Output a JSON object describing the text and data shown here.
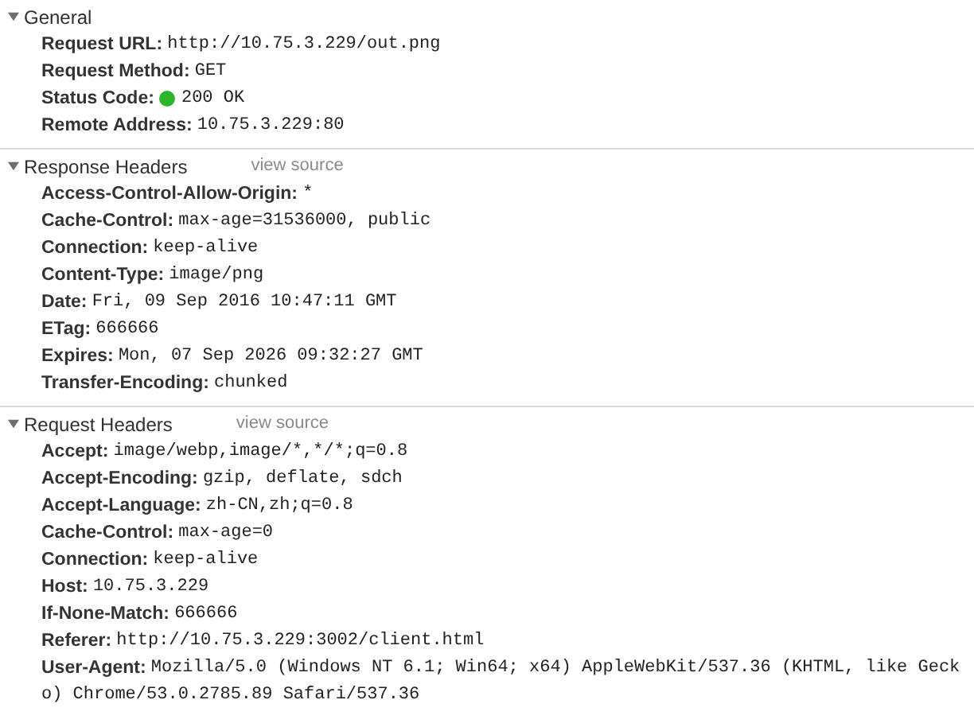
{
  "sections": [
    {
      "title": "General",
      "expanded": true,
      "rows": [
        {
          "name": "Request URL:",
          "value": "http://10.75.3.229/out.png",
          "kind": "plain"
        },
        {
          "name": "Request Method:",
          "value": "GET",
          "kind": "plain"
        },
        {
          "name": "Status Code:",
          "value": "200 OK",
          "kind": "status"
        },
        {
          "name": "Remote Address:",
          "value": "10.75.3.229:80",
          "kind": "plain"
        }
      ]
    },
    {
      "title": "Response Headers",
      "link": "view source",
      "expanded": true,
      "rows": [
        {
          "name": "Access-Control-Allow-Origin:",
          "value": "*",
          "kind": "plain"
        },
        {
          "name": "Cache-Control:",
          "value": "max-age=31536000, public",
          "kind": "plain"
        },
        {
          "name": "Connection:",
          "value": "keep-alive",
          "kind": "plain"
        },
        {
          "name": "Content-Type:",
          "value": "image/png",
          "kind": "plain"
        },
        {
          "name": "Date:",
          "value": "Fri, 09 Sep 2016 10:47:11 GMT",
          "kind": "plain"
        },
        {
          "name": "ETag:",
          "value": "666666",
          "kind": "plain"
        },
        {
          "name": "Expires:",
          "value": "Mon, 07 Sep 2026 09:32:27 GMT",
          "kind": "plain"
        },
        {
          "name": "Transfer-Encoding:",
          "value": "chunked",
          "kind": "plain"
        }
      ]
    },
    {
      "title": "Request Headers",
      "link": "view source",
      "expanded": true,
      "rows": [
        {
          "name": "Accept:",
          "value": "image/webp,image/*,*/*;q=0.8",
          "kind": "plain"
        },
        {
          "name": "Accept-Encoding:",
          "value": "gzip, deflate, sdch",
          "kind": "plain"
        },
        {
          "name": "Accept-Language:",
          "value": "zh-CN,zh;q=0.8",
          "kind": "plain"
        },
        {
          "name": "Cache-Control:",
          "value": "max-age=0",
          "kind": "plain"
        },
        {
          "name": "Connection:",
          "value": "keep-alive",
          "kind": "plain"
        },
        {
          "name": "Host:",
          "value": "10.75.3.229",
          "kind": "plain"
        },
        {
          "name": "If-None-Match:",
          "value": "666666",
          "kind": "plain"
        },
        {
          "name": "Referer:",
          "value": "http://10.75.3.229:3002/client.html",
          "kind": "plain"
        },
        {
          "name": "User-Agent:",
          "value": "Mozilla/5.0 (Windows NT 6.1; Win64; x64) AppleWebKit/537.36 (KHTML, like Gecko) Chrome/53.0.2785.89 Safari/537.36",
          "kind": "plain"
        }
      ]
    }
  ]
}
